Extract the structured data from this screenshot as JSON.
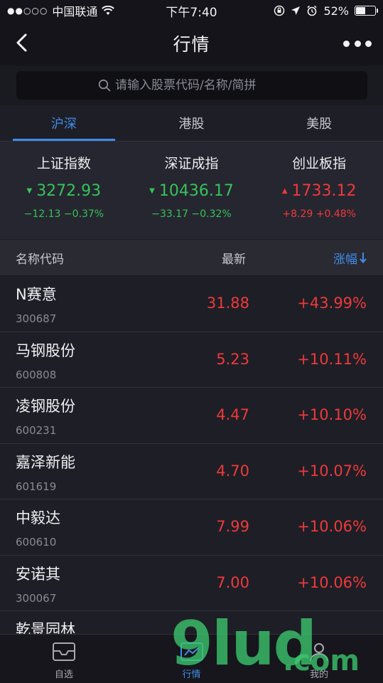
{
  "status_bar": {
    "carrier": "中国联通",
    "time": "下午7:40",
    "battery": "52%",
    "battery_level": 0.52
  },
  "nav": {
    "title": "行情"
  },
  "search": {
    "placeholder": "请输入股票代码/名称/简拼"
  },
  "tabs": [
    {
      "label": "沪深",
      "active": true
    },
    {
      "label": "港股",
      "active": false
    },
    {
      "label": "美股",
      "active": false
    }
  ],
  "indices": [
    {
      "name": "上证指数",
      "value": "3272.93",
      "change": "−12.13",
      "percent": "−0.37%",
      "direction": "down"
    },
    {
      "name": "深证成指",
      "value": "10436.17",
      "change": "−33.17",
      "percent": "−0.32%",
      "direction": "down"
    },
    {
      "name": "创业板指",
      "value": "1733.12",
      "change": "+8.29",
      "percent": "+0.48%",
      "direction": "up"
    }
  ],
  "list_header": {
    "name_code": "名称代码",
    "latest": "最新",
    "change": "涨幅"
  },
  "stocks": [
    {
      "name": "N赛意",
      "code": "300687",
      "price": "31.88",
      "change": "+43.99%"
    },
    {
      "name": "马钢股份",
      "code": "600808",
      "price": "5.23",
      "change": "+10.11%"
    },
    {
      "name": "凌钢股份",
      "code": "600231",
      "price": "4.47",
      "change": "+10.10%"
    },
    {
      "name": "嘉泽新能",
      "code": "601619",
      "price": "4.70",
      "change": "+10.07%"
    },
    {
      "name": "中毅达",
      "code": "600610",
      "price": "7.99",
      "change": "+10.06%"
    },
    {
      "name": "安诺其",
      "code": "300067",
      "price": "7.00",
      "change": "+10.06%"
    },
    {
      "name": "乾景园林",
      "code": "",
      "price": "",
      "change": ""
    }
  ],
  "tabbar": [
    {
      "label": "自选",
      "icon": "inbox-icon",
      "active": false
    },
    {
      "label": "行情",
      "icon": "chart-icon",
      "active": true
    },
    {
      "label": "我的",
      "icon": "person-icon",
      "active": false
    }
  ],
  "watermark": {
    "main": "9lud",
    "suffix": ".com"
  },
  "colors": {
    "accent": "#3f8ee8",
    "up": "#ee3a3a",
    "down": "#35c35a",
    "background": "#1e1e26"
  }
}
